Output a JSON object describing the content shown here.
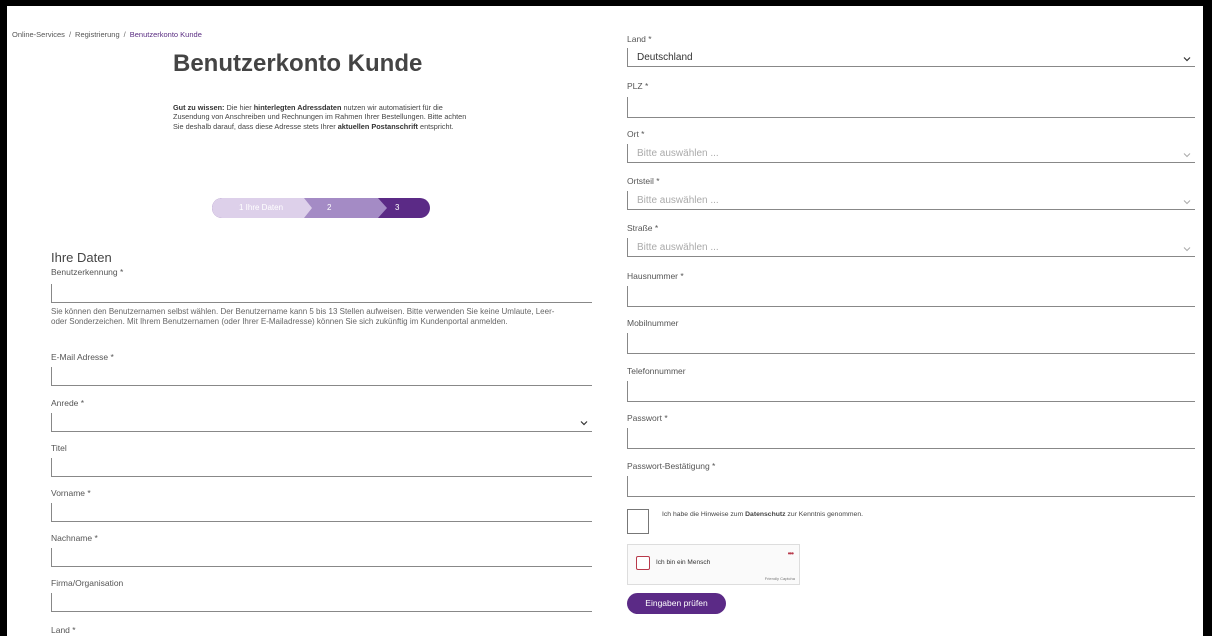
{
  "breadcrumb": {
    "items": [
      "Online-Services",
      "Registrierung",
      "Benutzerkonto Kunde"
    ],
    "separator": "/"
  },
  "page": {
    "title": "Benutzerkonto Kunde",
    "info": {
      "bold1": "Gut zu wissen:",
      "text1": " Die hier ",
      "bold2": "hinterlegten Adressdaten",
      "text2": " nutzen wir automatisiert für die Zusendung von Anschreiben und Rechnungen im Rahmen Ihrer Bestellungen. Bitte achten Sie deshalb darauf, dass diese Adresse stets Ihrer ",
      "bold3": "aktuellen Postanschrift",
      "text3": " entspricht."
    }
  },
  "steps": {
    "step1": "1 Ihre Daten",
    "step2": "2",
    "step3": "3",
    "current_step": 1,
    "total_steps": 3
  },
  "form_left": {
    "section_title": "Ihre Daten",
    "username_label": "Benutzerkennung *",
    "username_help": "Sie können den Benutzernamen selbst wählen. Der Benutzername kann 5 bis 13 Stellen aufweisen. Bitte verwenden Sie keine Umlaute, Leer- oder Sonderzeichen. Mit Ihrem Benutzernamen (oder Ihrer E-Mailadresse) können Sie sich zukünftig im Kundenportal anmelden.",
    "email_label": "E-Mail Adresse *",
    "salutation_label": "Anrede *",
    "title_label": "Titel",
    "firstname_label": "Vorname *",
    "lastname_label": "Nachname *",
    "company_label": "Firma/Organisation",
    "country_label_cut": "Land *"
  },
  "form_right": {
    "country_label": "Land *",
    "country_value": "Deutschland",
    "zip_label": "PLZ *",
    "city_label": "Ort *",
    "city_placeholder": "Bitte auswählen ...",
    "district_label": "Ortsteil *",
    "district_placeholder": "Bitte auswählen ...",
    "street_label": "Straße *",
    "street_placeholder": "Bitte auswählen ...",
    "housenumber_label": "Hausnummer *",
    "mobile_label": "Mobilnummer",
    "phone_label": "Telefonnummer",
    "password_label": "Passwort *",
    "password_confirm_label": "Passwort-Bestätigung *",
    "privacy": {
      "text1": "Ich habe die Hinweise zum ",
      "link": "Datenschutz",
      "text2": " zur Kenntnis genommen.",
      "checked": false
    },
    "captcha": {
      "text": "Ich bin ein Mensch",
      "brand": "Friendly Captcha",
      "menu": "•••"
    },
    "submit_label": "Eingaben prüfen"
  },
  "colors": {
    "brand_purple": "#5b2a86",
    "step_active": "#ddd0ea",
    "step_mid": "#a48bc5",
    "captcha_red": "#b83a4b"
  },
  "icons": {
    "select": "chevron-down-icon"
  }
}
